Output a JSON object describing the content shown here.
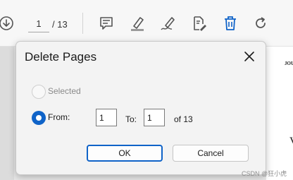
{
  "toolbar": {
    "page_current": "1",
    "page_total": "/ 13",
    "icons": [
      "download-icon",
      "comment-icon",
      "highlight-icon",
      "sign-icon",
      "edit-pdf-icon",
      "delete-icon",
      "rotate-icon"
    ],
    "accent": "#0f63c8"
  },
  "document": {
    "fragment_top": "JOU",
    "fragment_bottom": "V"
  },
  "dialog": {
    "title": "Delete Pages",
    "selected_label": "Selected",
    "from_label": "From:",
    "from_value": "1",
    "to_label": "To:",
    "to_value": "1",
    "of_label": "of 13",
    "ok_label": "OK",
    "cancel_label": "Cancel"
  },
  "watermark": "CSDN @狂小虎"
}
